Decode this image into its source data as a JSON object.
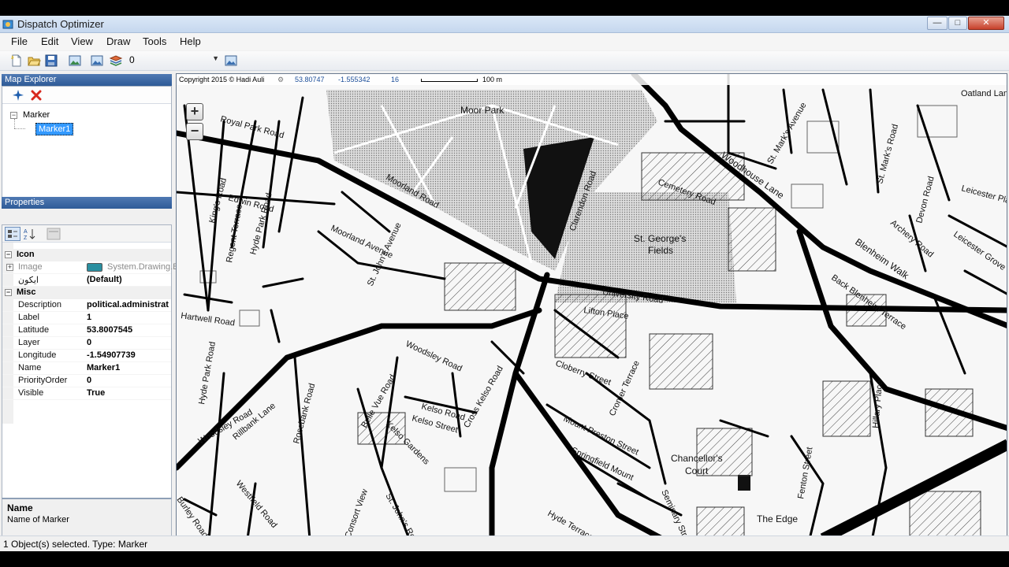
{
  "window": {
    "title": "Dispatch Optimizer",
    "minimize": "—",
    "maximize": "□",
    "close": "✕"
  },
  "menu": [
    "File",
    "Edit",
    "View",
    "Draw",
    "Tools",
    "Help"
  ],
  "toolbar": {
    "layer_value": "0",
    "icons": [
      "new-icon",
      "open-icon",
      "save-icon",
      "image-icon",
      "image-export-icon",
      "layers-icon",
      "map-image-icon"
    ]
  },
  "explorer": {
    "title": "Map Explorer",
    "tools": [
      "plane-icon",
      "delete-icon"
    ],
    "tree": {
      "root": "Marker",
      "child": "Marker1"
    }
  },
  "properties": {
    "title": "Properties",
    "categories": [
      {
        "name": "Icon",
        "rows": [
          {
            "name": "Image",
            "value": "System.Drawing.B",
            "gray": true
          },
          {
            "name": "ایکون",
            "value": "(Default)",
            "gray": false
          }
        ]
      },
      {
        "name": "Misc",
        "rows": [
          {
            "name": "Description",
            "value": "political.administrat",
            "gray": false
          },
          {
            "name": "Label",
            "value": "1",
            "gray": false
          },
          {
            "name": "Latitude",
            "value": "53.8007545",
            "gray": false
          },
          {
            "name": "Layer",
            "value": "0",
            "gray": false
          },
          {
            "name": "Longitude",
            "value": "-1.54907739",
            "gray": false
          },
          {
            "name": "Name",
            "value": "Marker1",
            "gray": false
          },
          {
            "name": "PriorityOrder",
            "value": "0",
            "gray": false
          },
          {
            "name": "Visible",
            "value": "True",
            "gray": false
          }
        ]
      }
    ],
    "help_title": "Name",
    "help_desc": "Name of Marker"
  },
  "map": {
    "copyright": "Copyright 2015 © Hadi Auli",
    "lat": "53.80747",
    "lon": "-1.555342",
    "zoom": "16",
    "scale": "100 m",
    "zoom_in": "+",
    "zoom_out": "−",
    "labels": {
      "moor_park": "Moor Park",
      "st_georges": "St. George's",
      "fields": "Fields",
      "chancellors": "Chancellor's",
      "court": "Court",
      "the_edge": "The Edge",
      "woodhouse_lane": "Woodhouse Lane",
      "blenheim_walk": "Blenheim Walk",
      "royal_park_road": "Royal Park Road",
      "moorland_road": "Moorland Road",
      "moorland_avenue": "Moorland Avenue",
      "clarendon_road": "Clarendon Road",
      "cemetery_road": "Cemetery Road",
      "university_road": "University Road",
      "lifton_place": "Lifton Place",
      "cloberry_street": "Cloberry Street",
      "woodsley_road": "Woodsley Road",
      "hartwell_road": "Hartwell Road",
      "hyde_park_road": "Hyde Park Road",
      "mount_preston_street": "Mount Preston Street",
      "springfield_mount": "Springfield Mount",
      "hyde_terrace": "Hyde Terrace",
      "kelso_road": "Kelso Road",
      "kelso_street": "Kelso Street",
      "belle_vue_road": "Belle Vue Road",
      "st_johns_avenue": "St. John's Avenue",
      "edwin_road": "Edwin Road",
      "woodsley_road2": "Woodsley Road",
      "rosebank_road": "Rosebank Road",
      "westfield_road": "Westfield Road",
      "burley_road": "Burley Road",
      "hillary_place": "Hillary Place",
      "fenton_street": "Fenton Street",
      "leicester_grove": "Leicester Grove",
      "back_blenheim": "Back Blenheim Terrace",
      "oatland_lane": "Oatland Lane",
      "st_marks_road": "St. Mark's Road",
      "st_marks_avenue": "St. Mark's Avenue",
      "devon_road": "Devon Road",
      "archery_road": "Archery Road",
      "leicester_place": "Leicester Place",
      "kings_road": "King's Road",
      "cross_kelso": "Cross Kelso Road",
      "regent_terrace": "Regent Terrace",
      "hyde_park_road2": "Hyde Park Road",
      "kelso_gardens": "Kelso Gardens",
      "st_johns_road": "St. John's Road",
      "consort_view": "Consort View",
      "rillbank_lane": "Rillbank Lane",
      "seminary_street": "Seminary Street",
      "cromer_terrace": "Cromer Terrace"
    }
  },
  "status": {
    "text": "1 Object(s) selected. Type: Marker"
  }
}
